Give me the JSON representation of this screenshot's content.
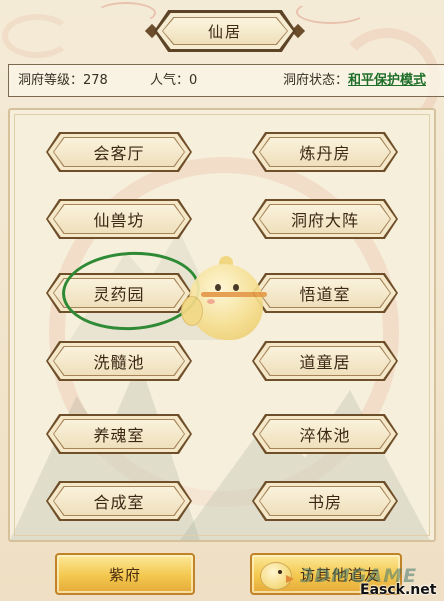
{
  "title": "仙居",
  "info_bar": {
    "level_label": "洞府等级：",
    "level_value": "278",
    "popularity_label": "人气：",
    "popularity_value": "0",
    "status_label": "洞府状态：",
    "status_value": "和平保护模式"
  },
  "rooms": [
    {
      "label": "会客厅"
    },
    {
      "label": "炼丹房"
    },
    {
      "label": "仙兽坊"
    },
    {
      "label": "洞府大阵"
    },
    {
      "label": "灵药园"
    },
    {
      "label": "悟道室"
    },
    {
      "label": "洗髓池"
    },
    {
      "label": "道童居"
    },
    {
      "label": "养魂室"
    },
    {
      "label": "淬体池"
    },
    {
      "label": "合成室"
    },
    {
      "label": "书房"
    }
  ],
  "bottom_buttons": {
    "zifu_label": "紫府",
    "visit_label": "访其他道友"
  },
  "watermark": {
    "brand": "3DMGAME",
    "site": "Easck.net"
  },
  "icons": {
    "mascot": "chick-mascot-icon",
    "visit_button_icon": "chick-icon",
    "banner_ornament": "diamond-ornament"
  },
  "colors": {
    "background": "#f4ebd7",
    "panel": "#f6efdc",
    "button_frame": "#6f4f2a",
    "button_text": "#3b2814",
    "status_green": "#1f6f2a",
    "annotation_green": "#2f8a35",
    "gold_button": "#f3c84e",
    "gold_border": "#c0832a"
  }
}
